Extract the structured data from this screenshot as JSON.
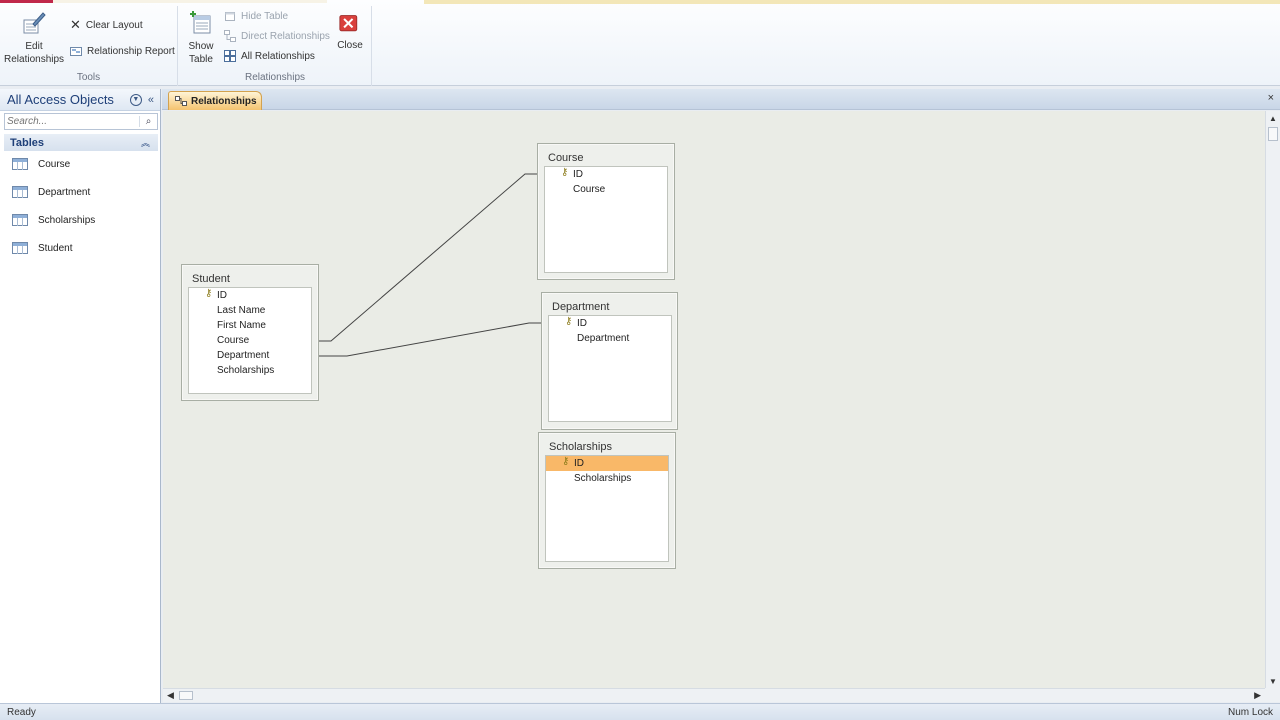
{
  "ribbon": {
    "tools_group_label": "Tools",
    "relationships_group_label": "Relationships",
    "edit_relationships_label_1": "Edit",
    "edit_relationships_label_2": "Relationships",
    "clear_layout_label": "Clear Layout",
    "relationship_report_label": "Relationship Report",
    "show_table_label_1": "Show",
    "show_table_label_2": "Table",
    "hide_table_label": "Hide Table",
    "direct_relationships_label": "Direct Relationships",
    "all_relationships_label": "All Relationships",
    "close_label": "Close"
  },
  "nav": {
    "title": "All Access Objects",
    "search_placeholder": "Search...",
    "group_label": "Tables",
    "items": [
      {
        "label": "Course"
      },
      {
        "label": "Department"
      },
      {
        "label": "Scholarships"
      },
      {
        "label": "Student"
      }
    ]
  },
  "doc": {
    "tab_label": "Relationships",
    "close_glyph": "×"
  },
  "tables": {
    "student": {
      "title": "Student",
      "fields": [
        "ID",
        "Last Name",
        "First Name",
        "Course",
        "Department",
        "Scholarships"
      ]
    },
    "course": {
      "title": "Course",
      "fields": [
        "ID",
        "Course"
      ]
    },
    "department": {
      "title": "Department",
      "fields": [
        "ID",
        "Department"
      ]
    },
    "scholarships": {
      "title": "Scholarships",
      "fields": [
        "ID",
        "Scholarships"
      ]
    }
  },
  "status": {
    "left": "Ready",
    "right": "Num Lock"
  },
  "colors": {
    "selected_field": "#f9b868",
    "tab_active": "#f4c36f",
    "nav_title": "#1e3f78"
  }
}
